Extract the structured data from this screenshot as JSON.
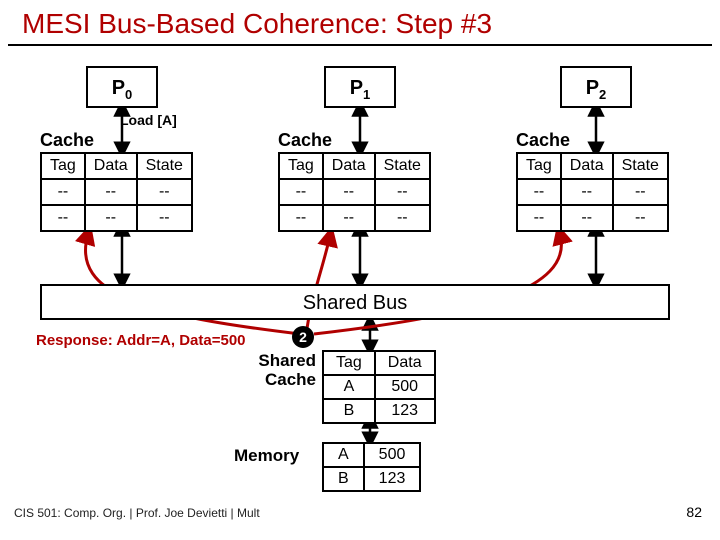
{
  "title": "MESI Bus-Based Coherence: Step #3",
  "processors": [
    "P",
    "P",
    "P"
  ],
  "processorSubs": [
    "0",
    "1",
    "2"
  ],
  "loadLabel": "Load [A]",
  "cacheWord": "Cache",
  "cacheHeaders": [
    "Tag",
    "Data",
    "State"
  ],
  "cacheRows": [
    [
      "--",
      "--",
      "--"
    ],
    [
      "--",
      "--",
      "--"
    ]
  ],
  "bus": "Shared Bus",
  "response": "Response: Addr=A, Data=500",
  "stepBadge": "2",
  "sharedCacheLabel": "Shared Cache",
  "memoryLabel": "Memory",
  "sharedCache": {
    "headers": [
      "Tag",
      "Data"
    ],
    "rows": [
      [
        "A",
        "500"
      ],
      [
        "B",
        "123"
      ]
    ]
  },
  "memory": {
    "rows": [
      [
        "A",
        "500"
      ],
      [
        "B",
        "123"
      ]
    ]
  },
  "footerLeft": "CIS 501: Comp. Org. | Prof. Joe Devietti | Mult",
  "footerRight": "82"
}
